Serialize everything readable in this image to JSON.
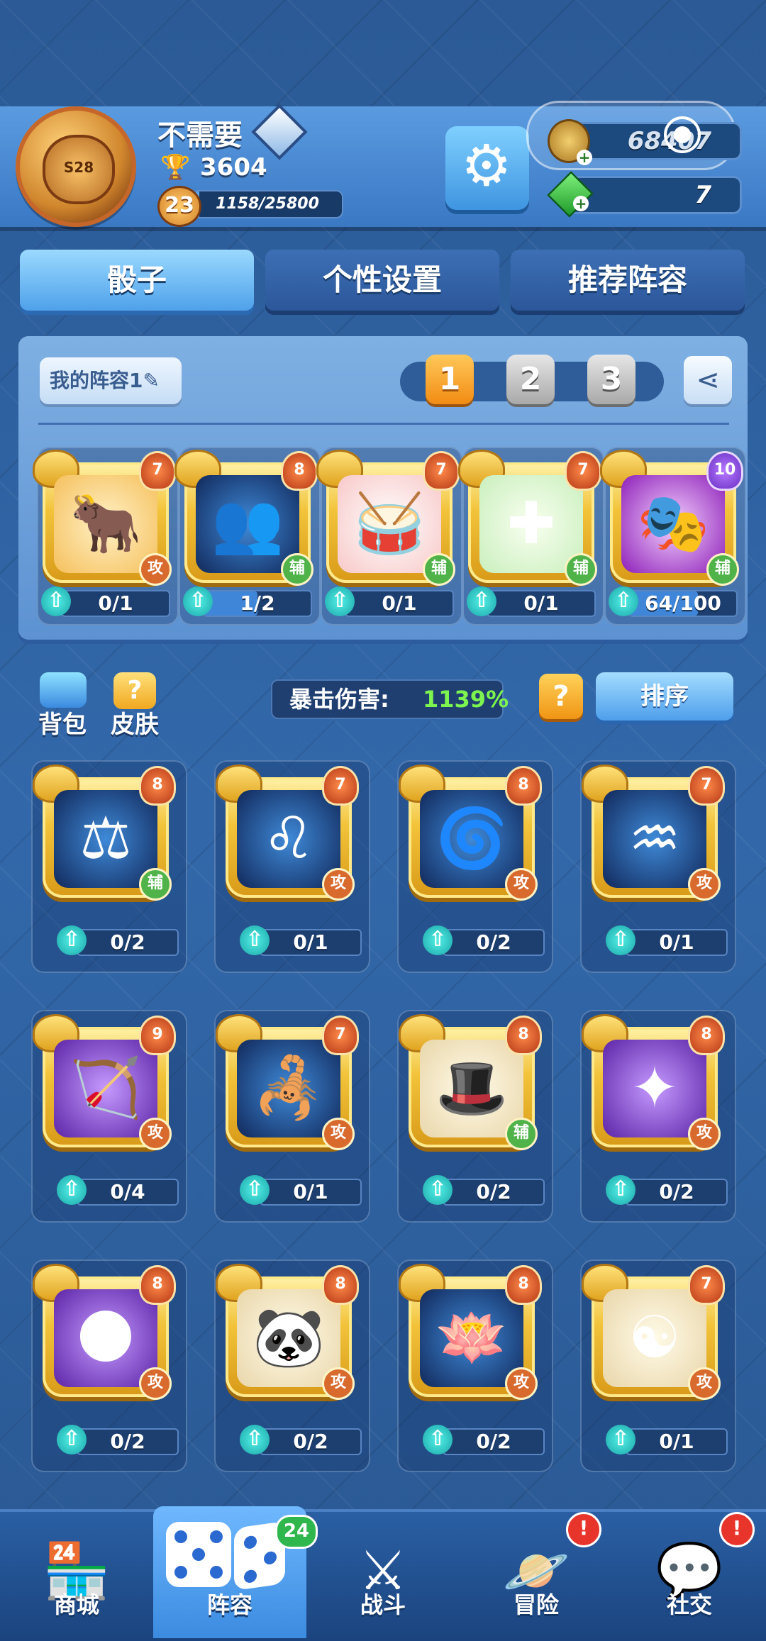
{
  "player": {
    "name": "不需要",
    "season_badge": "S28",
    "trophies": "3604",
    "level": "23",
    "xp_text": "1158/25800",
    "xp_fraction": 0.045
  },
  "currency": {
    "coins": "68407",
    "gems": "7"
  },
  "tabs": [
    "骰子",
    "个性设置",
    "推荐阵容"
  ],
  "lineup": {
    "my_lineup_label": "我的阵容1",
    "slots": [
      "1",
      "2",
      "3"
    ],
    "dice": [
      {
        "level": "7",
        "type": "攻",
        "progress": "0/1",
        "fill": 0.0,
        "theme": "gold",
        "glyph": "🐂"
      },
      {
        "level": "8",
        "type": "辅",
        "progress": "1/2",
        "fill": 0.5,
        "theme": "blue",
        "glyph": "👥"
      },
      {
        "level": "7",
        "type": "辅",
        "progress": "0/1",
        "fill": 0.0,
        "theme": "red",
        "glyph": "🥁"
      },
      {
        "level": "7",
        "type": "辅",
        "progress": "0/1",
        "fill": 0.0,
        "theme": "green",
        "glyph": "✚"
      },
      {
        "level": "10",
        "type": "辅",
        "progress": "64/100",
        "fill": 0.64,
        "theme": "pinkp",
        "glyph": "🎭"
      }
    ]
  },
  "tools": {
    "backpack_label": "背包",
    "skin_label": "皮肤",
    "crit_label": "暴击伤害:",
    "crit_value": "1139%",
    "help_glyph": "?",
    "sort_label": "排序"
  },
  "collection": [
    {
      "level": "8",
      "type": "辅",
      "progress": "0/2",
      "theme": "blue",
      "glyph": "⚖"
    },
    {
      "level": "7",
      "type": "攻",
      "progress": "0/1",
      "theme": "blue",
      "glyph": "♌"
    },
    {
      "level": "8",
      "type": "攻",
      "progress": "0/2",
      "theme": "blue",
      "glyph": "🌀"
    },
    {
      "level": "7",
      "type": "攻",
      "progress": "0/1",
      "theme": "blue",
      "glyph": "♒"
    },
    {
      "level": "9",
      "type": "攻",
      "progress": "0/4",
      "theme": "purple",
      "glyph": "🏹"
    },
    {
      "level": "7",
      "type": "攻",
      "progress": "0/1",
      "theme": "blue",
      "glyph": "🦂"
    },
    {
      "level": "8",
      "type": "辅",
      "progress": "0/2",
      "theme": "cream",
      "glyph": "🎩"
    },
    {
      "level": "8",
      "type": "攻",
      "progress": "0/2",
      "theme": "purple",
      "glyph": "✦"
    },
    {
      "level": "8",
      "type": "攻",
      "progress": "0/2",
      "theme": "purple",
      "glyph": "🌑"
    },
    {
      "level": "8",
      "type": "攻",
      "progress": "0/2",
      "theme": "cream",
      "glyph": "🐼"
    },
    {
      "level": "8",
      "type": "攻",
      "progress": "0/2",
      "theme": "blue",
      "glyph": "🪷"
    },
    {
      "level": "7",
      "type": "攻",
      "progress": "0/1",
      "theme": "cream",
      "glyph": "☯"
    }
  ],
  "nav": [
    {
      "label": "商城",
      "icon": "shop-icon",
      "glyph": "🏪",
      "badge": ""
    },
    {
      "label": "阵容",
      "icon": "dice-icon",
      "glyph": "",
      "badge": "24",
      "active": true
    },
    {
      "label": "战斗",
      "icon": "swords-icon",
      "glyph": "⚔",
      "badge": ""
    },
    {
      "label": "冒险",
      "icon": "planet-icon",
      "glyph": "🪐",
      "badge": "!"
    },
    {
      "label": "社交",
      "icon": "chat-icon",
      "glyph": "💬",
      "badge": "!"
    }
  ],
  "colors": {
    "background": "#2f5f9c",
    "accent_gold": "#f2c33a",
    "crit_green": "#7df44f",
    "alert_red": "#e8352c"
  }
}
